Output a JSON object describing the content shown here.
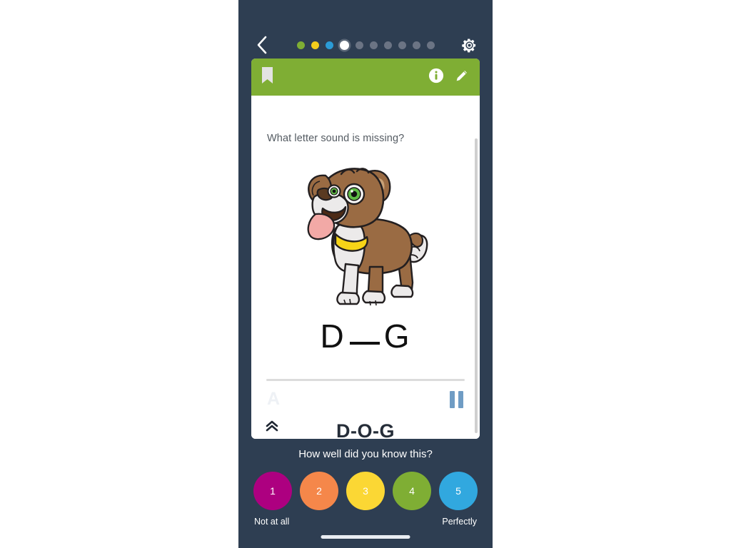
{
  "app": {
    "background_color": "#2e3e52",
    "card_accent_color": "#7fae34"
  },
  "topbar": {
    "back_icon": "chevron-left-icon",
    "settings_icon": "gear-icon",
    "progress_dots": [
      {
        "index": 1,
        "color": "#7fae34",
        "state": "complete"
      },
      {
        "index": 2,
        "color": "#f3cc1b",
        "state": "complete"
      },
      {
        "index": 3,
        "color": "#2b9bd6",
        "state": "complete"
      },
      {
        "index": 4,
        "color": "#ffffff",
        "state": "active"
      },
      {
        "index": 5,
        "color": "#6b7484",
        "state": "pending"
      },
      {
        "index": 6,
        "color": "#6b7484",
        "state": "pending"
      },
      {
        "index": 7,
        "color": "#6b7484",
        "state": "pending"
      },
      {
        "index": 8,
        "color": "#6b7484",
        "state": "pending"
      },
      {
        "index": 9,
        "color": "#6b7484",
        "state": "pending"
      },
      {
        "index": 10,
        "color": "#6b7484",
        "state": "pending"
      }
    ]
  },
  "card": {
    "header": {
      "bookmark_icon": "bookmark-icon",
      "info_icon": "info-icon",
      "edit_icon": "pencil-icon"
    },
    "question": "What letter sound is missing?",
    "image_alt": "cartoon brown and white dog with tongue out and yellow collar",
    "prompt": {
      "first_letter": "D",
      "blank": "__",
      "last_letter": "G"
    },
    "audio": {
      "label": "A",
      "control_icon": "pause-icon",
      "control_state": "playing"
    },
    "answer": "D-O-G",
    "collapse_icon": "chevron-double-up-icon"
  },
  "rating": {
    "title": "How well did you know this?",
    "buttons": [
      {
        "value": "1",
        "color": "#ad0080"
      },
      {
        "value": "2",
        "color": "#f5874a"
      },
      {
        "value": "3",
        "color": "#fbd734"
      },
      {
        "value": "4",
        "color": "#7fae34"
      },
      {
        "value": "5",
        "color": "#31a8df"
      }
    ],
    "left_label": "Not at all",
    "right_label": "Perfectly"
  },
  "system": {
    "home_indicator": "home-indicator"
  }
}
